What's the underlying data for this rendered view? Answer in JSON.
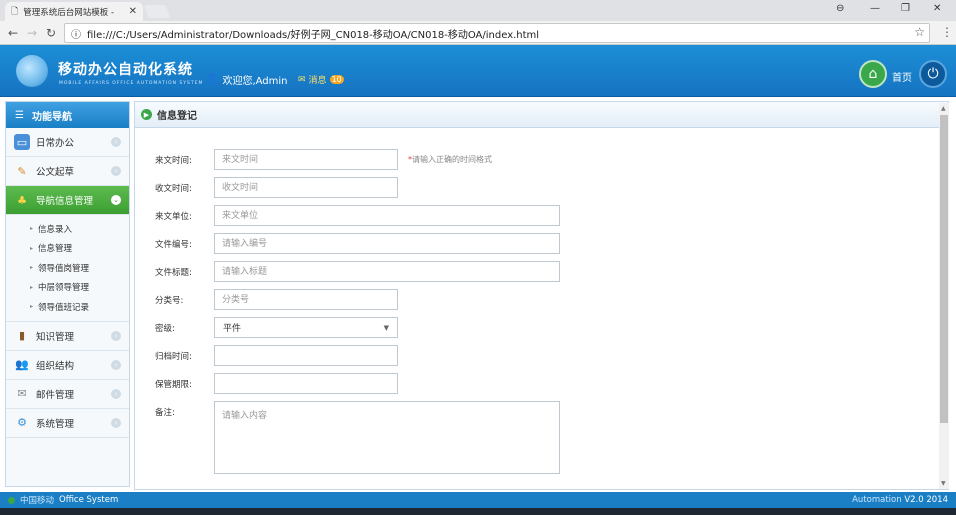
{
  "browser": {
    "tab_title": "管理系统后台网站模板 -",
    "address": "file:///C:/Users/Administrator/Downloads/好例子网_CN018-移动OA/CN018-移动OA/index.html"
  },
  "header": {
    "brand": "移动办公自动化系统",
    "brand_sub": "MOBILE AFFAIRS OFFICE AUTOMATION SYSTEM",
    "welcome": "欢迎您,Admin",
    "messages_label": "消息",
    "messages_count": "10",
    "home_label": "首页"
  },
  "sidebar": {
    "title": "功能导航",
    "items": [
      {
        "label": "日常办公",
        "icon": "monitor-icon",
        "active": false
      },
      {
        "label": "公文起草",
        "icon": "pencil-icon",
        "active": false
      },
      {
        "label": "导航信息管理",
        "icon": "tree-icon",
        "active": true
      },
      {
        "label": "知识管理",
        "icon": "book-icon",
        "active": false
      },
      {
        "label": "组织结构",
        "icon": "people-icon",
        "active": false
      },
      {
        "label": "邮件管理",
        "icon": "envelope-icon",
        "active": false
      },
      {
        "label": "系统管理",
        "icon": "gears-icon",
        "active": false
      }
    ],
    "subitems": [
      "信息录入",
      "信息管理",
      "领导值岗管理",
      "中层领导管理",
      "领导值班记录"
    ]
  },
  "main": {
    "title": "信息登记",
    "fields": {
      "date_in": {
        "label": "来文时间:",
        "placeholder": "来文时间"
      },
      "date_in_hint_mark": "*",
      "date_in_hint": "请输入正确的时间格式",
      "date_recv": {
        "label": "收文时间:",
        "placeholder": "收文时间"
      },
      "unit": {
        "label": "来文单位:",
        "placeholder": "来文单位"
      },
      "doc_no": {
        "label": "文件编号:",
        "placeholder": "请输入编号"
      },
      "doc_title": {
        "label": "文件标题:",
        "placeholder": "请输入标题"
      },
      "category": {
        "label": "分类号:",
        "placeholder": "分类号"
      },
      "secret": {
        "label": "密级:",
        "value": "平件"
      },
      "archive_time": {
        "label": "归档时间:",
        "placeholder": ""
      },
      "keep_period": {
        "label": "保管期限:",
        "placeholder": ""
      },
      "remark": {
        "label": "备注:",
        "placeholder": "请输入内容"
      }
    }
  },
  "footer": {
    "left_cn": "中国移动",
    "left_en": "Office System",
    "right_label": "Automation",
    "version": "V2.0 2014"
  },
  "colors": {
    "primary": "#1b7fc6",
    "active_green": "#3c9e32",
    "required": "#e33"
  }
}
